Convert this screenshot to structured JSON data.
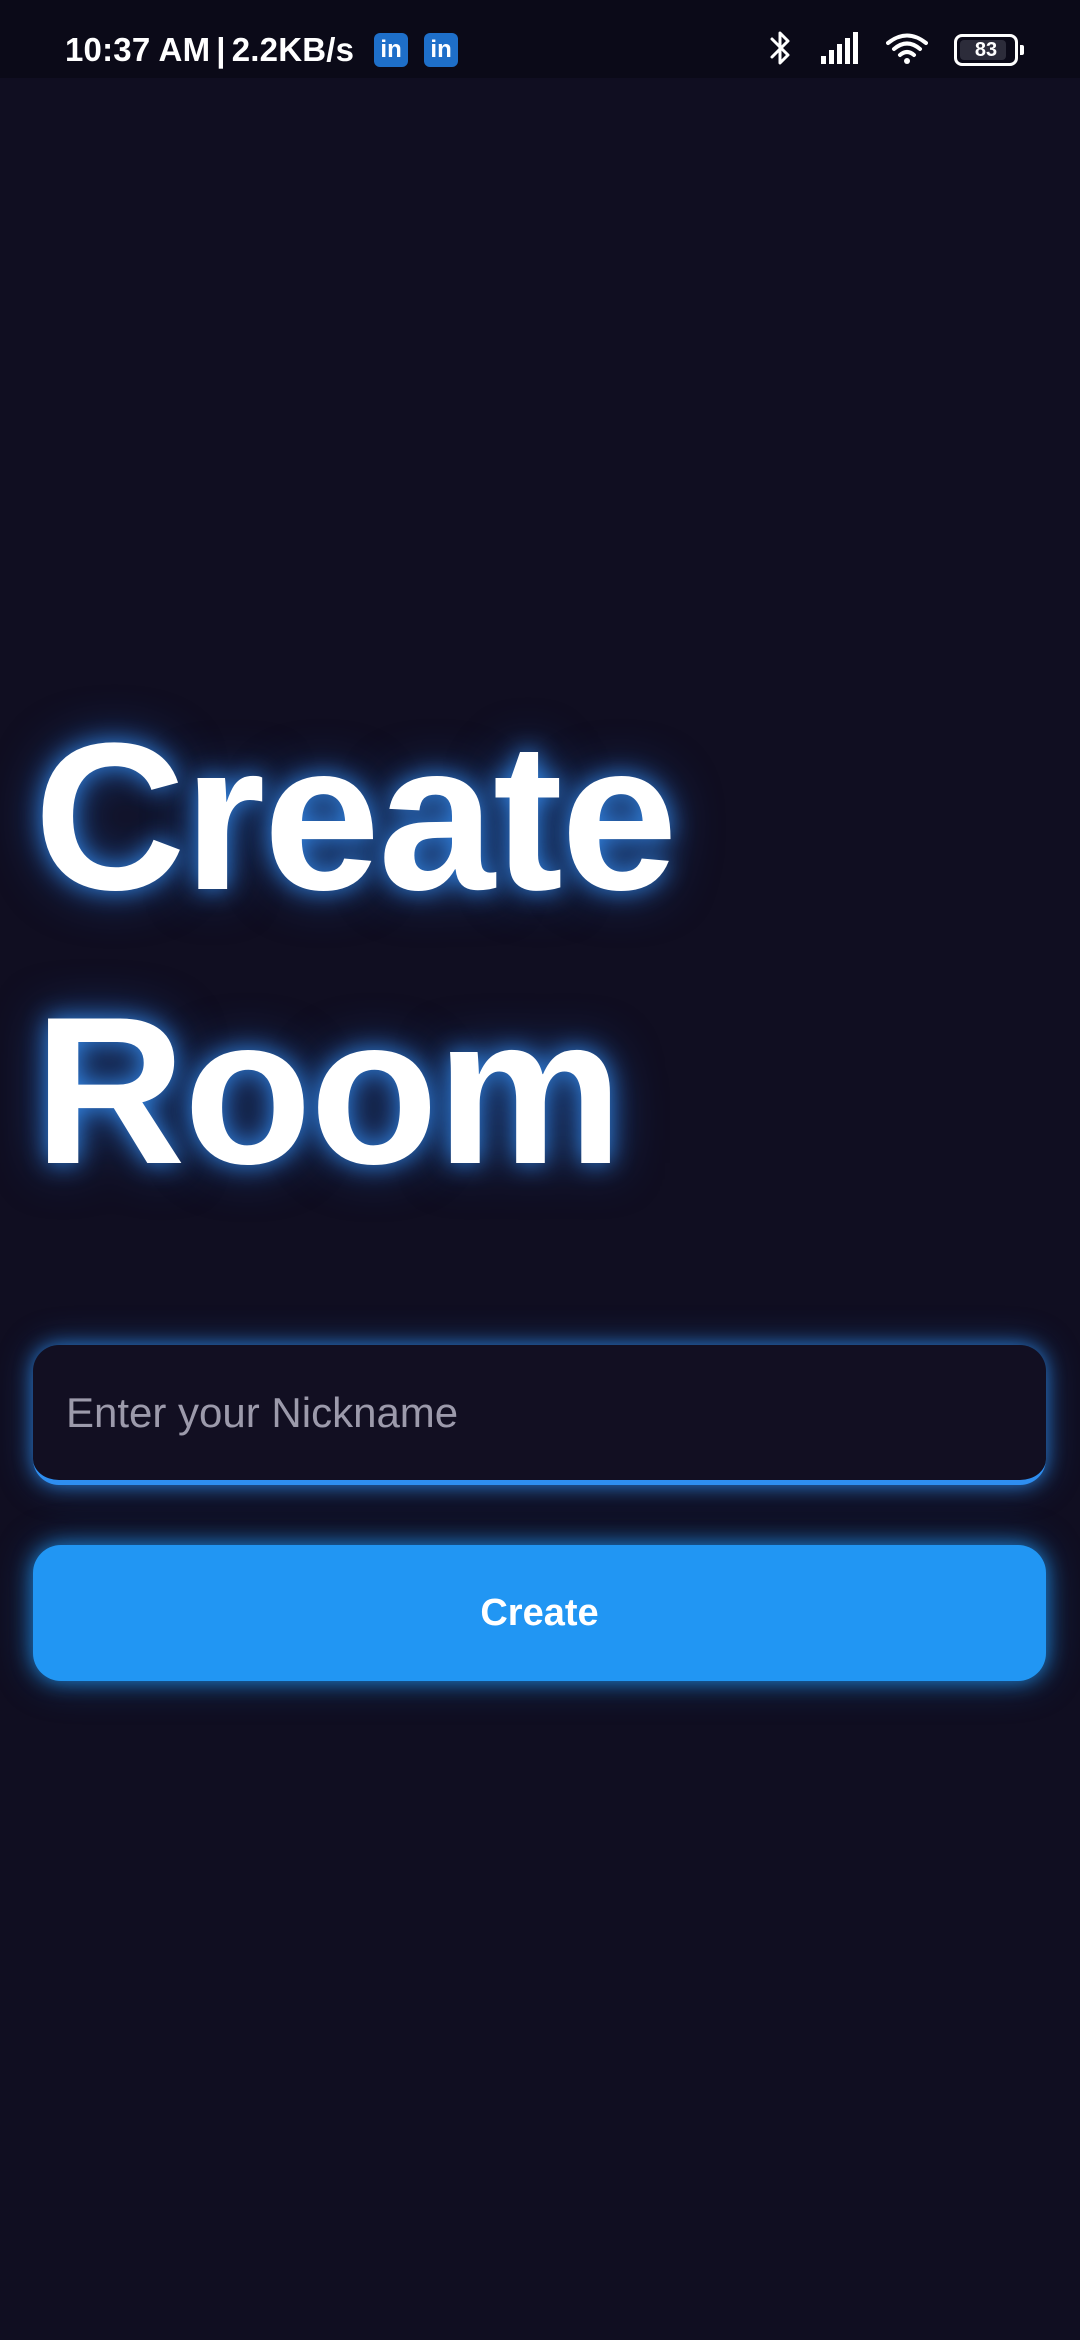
{
  "status_bar": {
    "time": "10:37 AM",
    "separator": "|",
    "network_speed": "2.2KB/s",
    "notification_icons": [
      "linkedin-icon",
      "linkedin-icon"
    ],
    "linkedin_label": "in",
    "battery_level": "83",
    "system_icons": [
      "bluetooth-icon",
      "signal-icon",
      "wifi-icon",
      "battery-icon"
    ]
  },
  "page": {
    "title_line1": "Create",
    "title_line2": "Room"
  },
  "form": {
    "nickname_placeholder": "Enter your Nickname",
    "nickname_value": "",
    "create_label": "Create"
  },
  "colors": {
    "background": "#100e21",
    "accent": "#2196f3",
    "glow": "#2e8ef0",
    "placeholder": "#9c9aab"
  }
}
